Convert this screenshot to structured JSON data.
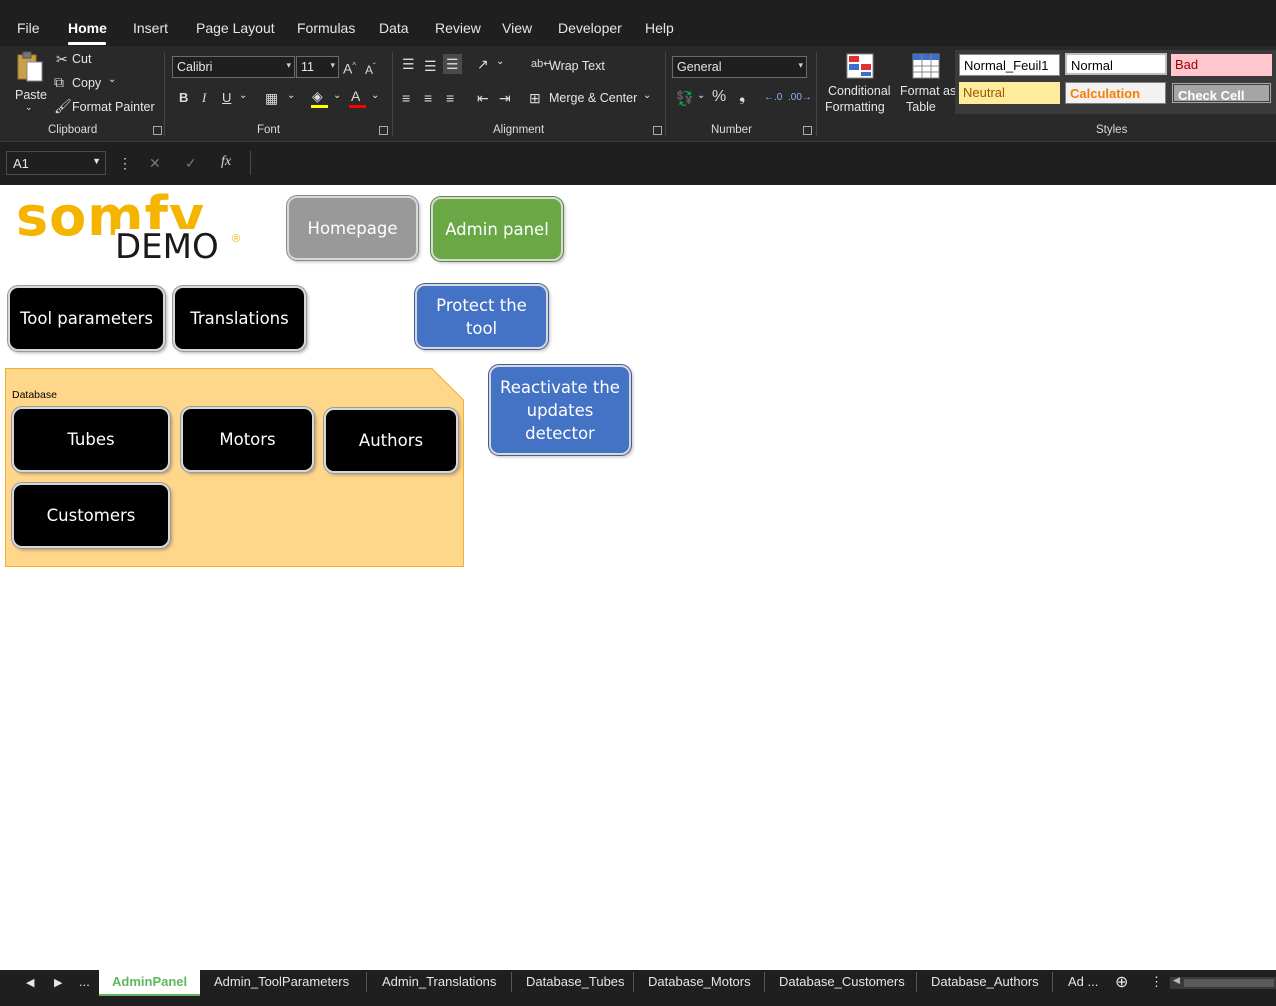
{
  "menu": {
    "items": [
      "File",
      "Home",
      "Insert",
      "Page Layout",
      "Formulas",
      "Data",
      "Review",
      "View",
      "Developer",
      "Help"
    ]
  },
  "ribbon": {
    "clipboard": {
      "paste": "Paste",
      "cut": "Cut",
      "copy": "Copy",
      "format_painter": "Format Painter",
      "label": "Clipboard"
    },
    "font": {
      "name": "Calibri",
      "size": "11",
      "bold": "B",
      "italic": "I",
      "underline": "U",
      "label": "Font"
    },
    "alignment": {
      "wrap_text": "Wrap Text",
      "merge_center": "Merge & Center",
      "label": "Alignment"
    },
    "number": {
      "format": "General",
      "label": "Number"
    },
    "styles": {
      "conditional_formatting_1": "Conditional",
      "conditional_formatting_2": "Formatting",
      "format_as_table_1": "Format as",
      "format_as_table_2": "Table",
      "cells": [
        "Normal_Feuil1",
        "Normal",
        "Bad",
        "Neutral",
        "Calculation",
        "Check Cell"
      ],
      "label": "Styles"
    }
  },
  "formula_bar": {
    "name_box": "A1",
    "fx": "fx"
  },
  "sheet": {
    "logo_text": "somfy",
    "demo_text": "DEMO",
    "buttons": {
      "homepage": "Homepage",
      "admin_panel": "Admin panel",
      "tool_parameters": "Tool parameters",
      "translations": "Translations",
      "protect": "Protect the tool",
      "reactivate": "Reactivate the updates detector",
      "tubes": "Tubes",
      "motors": "Motors",
      "authors": "Authors",
      "customers": "Customers"
    },
    "database_label": "Database"
  },
  "tabs": [
    "AdminPanel",
    "Admin_ToolParameters",
    "Admin_Translations",
    "Database_Tubes",
    "Database_Motors",
    "Database_Customers",
    "Database_Authors",
    "Ad ..."
  ],
  "colors": {
    "accent_tab": "#5fb85f",
    "black_button": "#000000",
    "grey_button": "#999999",
    "green_button": "#6aa846",
    "blue_button": "#4472c4",
    "database_panel": "#ffd78b",
    "somfy_orange": "#f5b400"
  }
}
